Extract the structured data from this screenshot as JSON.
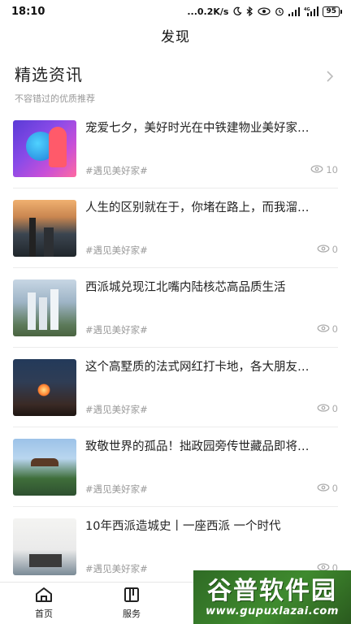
{
  "status_bar": {
    "time": "18:10",
    "network_speed": "...0.2K/s",
    "network_type": "4G",
    "battery": "95",
    "icons": [
      "moon-icon",
      "bluetooth-icon",
      "eye-icon",
      "alarm-icon",
      "signal-icon",
      "signal-4g-icon",
      "battery-icon"
    ]
  },
  "page": {
    "title": "发现"
  },
  "section": {
    "title": "精选资讯",
    "subtitle": "不容错过的优质推荐",
    "more_icon": "chevron-right-icon"
  },
  "news": [
    {
      "title": "宠爱七夕，美好时光在中铁建物业美好家…",
      "tag": "#遇见美好家#",
      "views": "10",
      "thumb": "qixi-illustration"
    },
    {
      "title": "人生的区别就在于，你堵在路上，而我溜…",
      "tag": "#遇见美好家#",
      "views": "0",
      "thumb": "city-sunset"
    },
    {
      "title": "西派城兑现江北嘴内陆核芯高品质生活",
      "tag": "#遇见美好家#",
      "views": "0",
      "thumb": "riverside-towers"
    },
    {
      "title": "这个高墅质的法式网红打卡地，各大朋友…",
      "tag": "#遇见美好家#",
      "views": "0",
      "thumb": "night-campfire"
    },
    {
      "title": "致敬世界的孤品！拙政园旁传世藏品即将…",
      "tag": "#遇见美好家#",
      "views": "0",
      "thumb": "classical-garden"
    },
    {
      "title": "10年西派造城史丨一座西派 一个时代",
      "tag": "#遇见美好家#",
      "views": "0",
      "thumb": "building-sign"
    }
  ],
  "bottom_nav": [
    {
      "label": "首页",
      "icon": "home-icon"
    },
    {
      "label": "服务",
      "icon": "service-grid-icon"
    }
  ],
  "watermark": {
    "title": "谷普软件园",
    "url": "www.gupuxlazai.com"
  },
  "colors": {
    "text_primary": "#222222",
    "text_secondary": "#999999",
    "divider": "#ececec",
    "watermark_green": "#3f8a2e"
  }
}
